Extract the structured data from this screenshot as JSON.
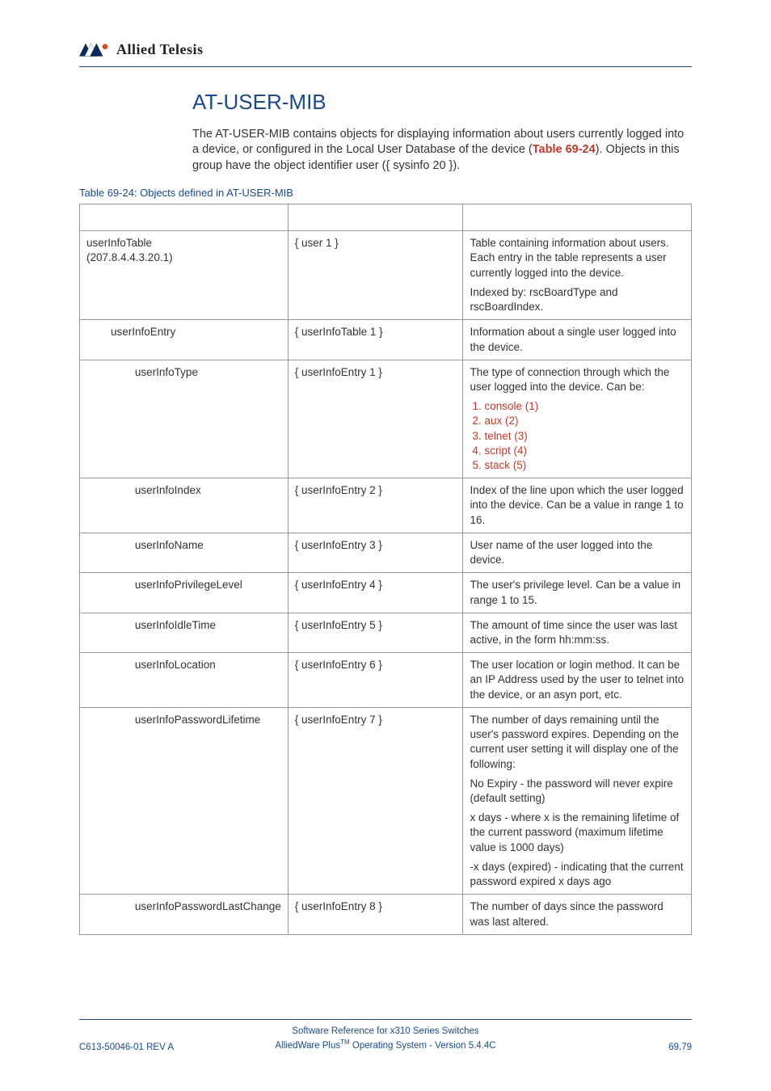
{
  "logo_text": "Allied Telesis",
  "title": "AT-USER-MIB",
  "intro_a": "The AT-USER-MIB contains objects for displaying information about users currently logged into a device, or configured in the Local User Database of the device (",
  "intro_link": "Table 69-24",
  "intro_b": "). Objects in this group have the object identifier user ({ sysinfo 20 }).",
  "table_caption": "Table 69-24: Objects defined in AT-USER-MIB",
  "rows": [
    {
      "indent": 0,
      "name": "userInfoTable",
      "name_sub": "(207.8.4.4.3.20.1)",
      "oid": "{ user 1 }",
      "desc": [
        "Table containing information about users. Each entry in the table represents a user currently logged into the device.",
        "Indexed by: rscBoardType and rscBoardIndex."
      ]
    },
    {
      "indent": 1,
      "name": "userInfoEntry",
      "oid": "{ userInfoTable 1 }",
      "desc": [
        "Information about a single user logged into the device."
      ]
    },
    {
      "indent": 2,
      "name": "userInfoType",
      "oid": "{ userInfoEntry 1 }",
      "desc_pre": "The type of connection through which the user logged into the device. Can be:",
      "enum": [
        "console (1)",
        "aux (2)",
        "telnet (3)",
        "script (4)",
        "stack (5)"
      ]
    },
    {
      "indent": 2,
      "name": "userInfoIndex",
      "oid": "{ userInfoEntry 2 }",
      "desc": [
        "Index of the line upon which the user logged into the device. Can be a value in range 1 to 16."
      ]
    },
    {
      "indent": 2,
      "name": "userInfoName",
      "oid": "{ userInfoEntry 3 }",
      "desc": [
        "User name of the user logged into the device."
      ]
    },
    {
      "indent": 2,
      "name": "userInfoPrivilegeLevel",
      "oid": "{ userInfoEntry 4 }",
      "desc": [
        "The user's privilege level. Can be a value in range 1 to 15."
      ]
    },
    {
      "indent": 2,
      "name": "userInfoIdleTime",
      "oid": "{ userInfoEntry 5 }",
      "desc": [
        "The amount of time since the user was last active, in the form hh:mm:ss."
      ]
    },
    {
      "indent": 2,
      "name": "userInfoLocation",
      "oid": "{ userInfoEntry 6 }",
      "desc": [
        "The user location or login method. It can be an IP Address used by the user to telnet into the device, or an asyn port, etc."
      ]
    },
    {
      "indent": 2,
      "name": "userInfoPasswordLifetime",
      "oid": "{ userInfoEntry 7 }",
      "desc": [
        "The number of days remaining until the user's password expires. Depending on the current user setting it will display one of the following:",
        "No Expiry - the password will never expire (default setting)",
        "x days - where x is the remaining lifetime of the current password (maximum lifetime value is 1000 days)",
        "-x days (expired) - indicating that the current password expired x days ago"
      ]
    },
    {
      "indent": 2,
      "name": "userInfoPasswordLastChange",
      "oid": "{ userInfoEntry 8 }",
      "desc": [
        "The number of days since the password was last altered."
      ]
    }
  ],
  "footer": {
    "line1": "Software Reference for x310 Series Switches",
    "line2_a": "AlliedWare Plus",
    "line2_tm": "TM",
    "line2_b": " Operating System - Version 5.4.4C",
    "left": "C613-50046-01 REV A",
    "right": "69.79"
  }
}
